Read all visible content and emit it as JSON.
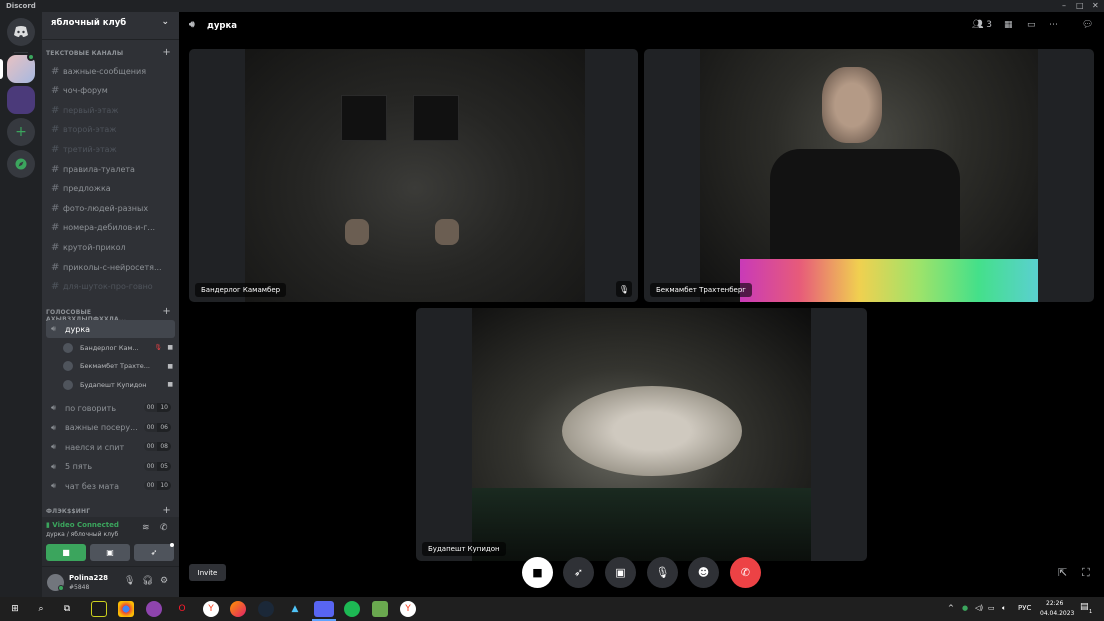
{
  "app": {
    "title": "Discord",
    "window_controls": [
      "–",
      "□",
      "✕"
    ]
  },
  "server": {
    "name": "яблочный клуб"
  },
  "categories": {
    "text": "ТЕКСТОВЫЕ КАНАЛЫ",
    "voice": "ГОЛОСОВЫЕ АХЫВЗХЛЫПФХХЛА...",
    "other": "ФЛЭК$$ИНГ"
  },
  "text_channels": [
    {
      "name": "важные-сообщения",
      "muted": false
    },
    {
      "name": "чоч-форум",
      "muted": false
    },
    {
      "name": "первый-этаж",
      "muted": true
    },
    {
      "name": "второй-этаж",
      "muted": true
    },
    {
      "name": "третий-этаж",
      "muted": true
    },
    {
      "name": "правила-туалета",
      "muted": false
    },
    {
      "name": "предложка",
      "muted": false
    },
    {
      "name": "фото-людей-разных",
      "muted": false
    },
    {
      "name": "номера-дебилов-и-г...",
      "muted": false
    },
    {
      "name": "крутой-прикол",
      "muted": false
    },
    {
      "name": "приколы-с-нейросетя...",
      "muted": false
    },
    {
      "name": "для-шуток-про-говно",
      "muted": true
    }
  ],
  "voice_channels": [
    {
      "name": "дурка",
      "active": true
    },
    {
      "name": "по говорить",
      "count": "00",
      "limit": "10"
    },
    {
      "name": "важные посеру...",
      "count": "00",
      "limit": "06"
    },
    {
      "name": "наелся и спит",
      "count": "00",
      "limit": "08"
    },
    {
      "name": "5 пять",
      "count": "00",
      "limit": "05"
    },
    {
      "name": "чат без мата",
      "count": "00",
      "limit": "10"
    }
  ],
  "voice_users": [
    {
      "name": "Бандерлог Кам...",
      "icons": [
        "muted-mic-icon",
        "camera-icon"
      ]
    },
    {
      "name": "Бекмамбет Трахте...",
      "icons": [
        "camera-icon"
      ]
    },
    {
      "name": "Будапешт Купидон",
      "icons": [
        "camera-icon"
      ]
    }
  ],
  "voice_panel": {
    "status": "Video Connected",
    "location": "дурка / яблочный клуб"
  },
  "user": {
    "name": "Polina228",
    "tag": "#5848"
  },
  "call": {
    "channel": "дурка",
    "participants_count": "3",
    "tiles": [
      {
        "label": "Бандерлог Камамбер",
        "muted": true
      },
      {
        "label": "Бекмамбет Трахтенберг",
        "muted": false
      },
      {
        "label": "Будапешт Купидон",
        "muted": false
      }
    ],
    "invite_label": "Invite"
  },
  "taskbar": {
    "lang": "РУС",
    "time": "22:26",
    "date": "04.04.2023",
    "notif_count": "1"
  },
  "colors": {
    "accent": "#3ba55d",
    "danger": "#ed4245",
    "brand": "#5865f2",
    "bg": "#202225"
  }
}
